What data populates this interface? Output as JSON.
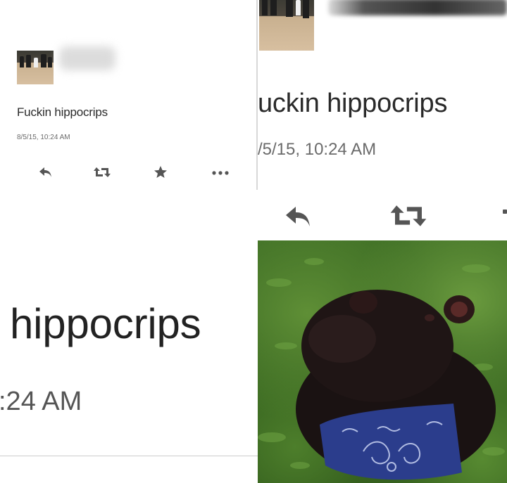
{
  "panels": {
    "top_left": {
      "tweet_text": "Fuckin hippocrips",
      "timestamp": "8/5/15, 10:24 AM",
      "actions": [
        "reply-icon",
        "retweet-icon",
        "favorite-icon",
        "more-icon"
      ]
    },
    "top_right": {
      "tweet_text": "uckin hippocrips",
      "timestamp": "/5/15, 10:24 AM",
      "actions": [
        "reply-icon",
        "retweet-icon"
      ]
    },
    "bottom_left": {
      "tweet_text": "hippocrips",
      "timestamp": ":24 AM"
    },
    "bottom_right": {
      "image": "hippo-with-blue-bandana"
    }
  },
  "colors": {
    "icon_gray": "#555555",
    "timestamp_gray": "#6b6b6b",
    "text": "#2a2a2a",
    "grass_green": "#3e6e25",
    "bandana_blue": "#2b3d8c"
  }
}
